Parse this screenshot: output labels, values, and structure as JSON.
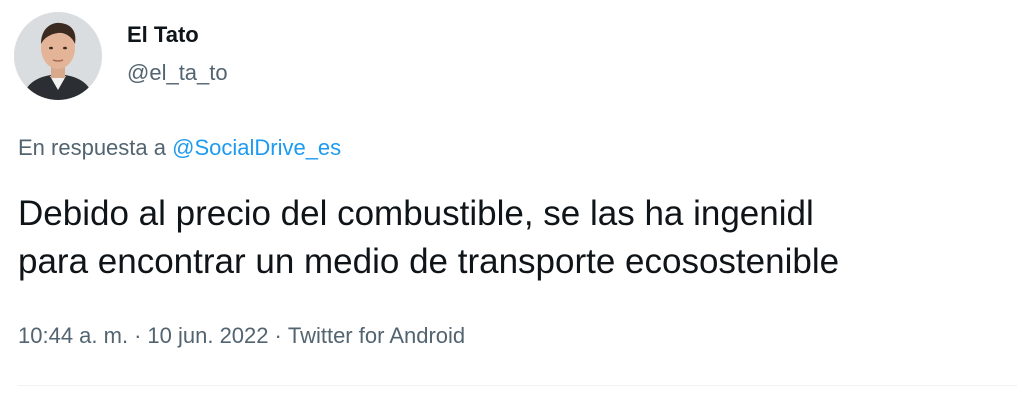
{
  "author": {
    "display_name": "El Tato",
    "handle": "@el_ta_to",
    "avatar": "profile-photo"
  },
  "reply": {
    "prefix": "En respuesta a",
    "mention": "@SocialDrive_es"
  },
  "tweet": {
    "line1": "Debido al precio del combustible, se las ha ingenidl",
    "line2": "para encontrar un medio de transporte ecosostenible"
  },
  "meta": {
    "time": "10:44 a. m.",
    "separator": "·",
    "date": "10 jun. 2022",
    "source": "Twitter for Android"
  },
  "colors": {
    "text": "#0f1419",
    "secondary": "#536471",
    "link": "#1d9bf0"
  }
}
